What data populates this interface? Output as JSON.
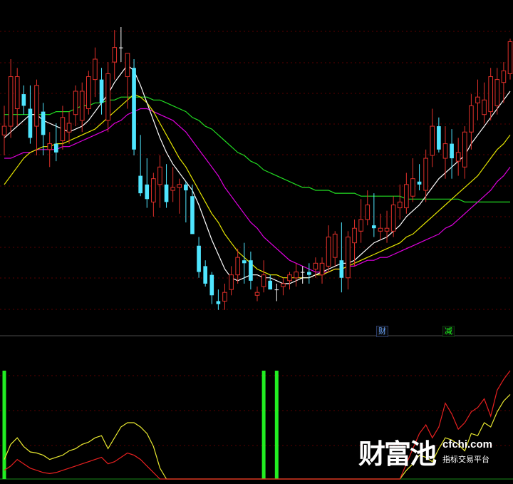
{
  "colors": {
    "background": "#000000",
    "grid": "#5a0000",
    "separator": "#4a4a4a",
    "candle_up": "#e0302a",
    "candle_down": "#4fe6ff",
    "doji": "#ffffff",
    "ma_short": "#ffffff",
    "ma_mid": "#e6e600",
    "ma_long": "#e000e0",
    "ma_longest": "#22dd22",
    "ind_yellow": "#e8e830",
    "ind_red": "#e82020",
    "ind_bar": "#22ee22"
  },
  "markers": {
    "cai": "财",
    "jian": "减"
  },
  "watermark": {
    "name": "财富池",
    "url": "cfchi.com",
    "tagline": "指标交易平台"
  },
  "chart_data": [
    {
      "type": "candlestick",
      "ylim": [
        0,
        100
      ],
      "grid": true,
      "candles": [
        {
          "o": 63,
          "h": 73,
          "l": 56,
          "c": 66
        },
        {
          "o": 66,
          "h": 89,
          "l": 62,
          "c": 83
        },
        {
          "o": 72,
          "h": 86,
          "l": 66,
          "c": 83
        },
        {
          "o": 77,
          "h": 80,
          "l": 70,
          "c": 73
        },
        {
          "o": 72,
          "h": 80,
          "l": 60,
          "c": 62
        },
        {
          "o": 66,
          "h": 82,
          "l": 56,
          "c": 80
        },
        {
          "o": 71,
          "h": 74,
          "l": 56,
          "c": 63
        },
        {
          "o": 58,
          "h": 64,
          "l": 52,
          "c": 60
        },
        {
          "o": 60,
          "h": 67,
          "l": 54,
          "c": 57
        },
        {
          "o": 61,
          "h": 73,
          "l": 58,
          "c": 69
        },
        {
          "o": 64,
          "h": 71,
          "l": 60,
          "c": 67
        },
        {
          "o": 70,
          "h": 80,
          "l": 66,
          "c": 78
        },
        {
          "o": 68,
          "h": 81,
          "l": 64,
          "c": 78
        },
        {
          "o": 72,
          "h": 85,
          "l": 70,
          "c": 83
        },
        {
          "o": 82,
          "h": 93,
          "l": 76,
          "c": 89
        },
        {
          "o": 82,
          "h": 86,
          "l": 70,
          "c": 74
        },
        {
          "o": 68,
          "h": 88,
          "l": 64,
          "c": 84
        },
        {
          "o": 88,
          "h": 99,
          "l": 82,
          "c": 93
        },
        {
          "o": 93,
          "h": 100,
          "l": 88,
          "c": 93
        },
        {
          "o": 83,
          "h": 91,
          "l": 72,
          "c": 91
        },
        {
          "o": 86,
          "h": 89,
          "l": 56,
          "c": 58
        },
        {
          "o": 49,
          "h": 63,
          "l": 42,
          "c": 43
        },
        {
          "o": 46,
          "h": 55,
          "l": 38,
          "c": 41
        },
        {
          "o": 40,
          "h": 50,
          "l": 35,
          "c": 48
        },
        {
          "o": 46,
          "h": 56,
          "l": 38,
          "c": 52
        },
        {
          "o": 46,
          "h": 53,
          "l": 38,
          "c": 40
        },
        {
          "o": 44,
          "h": 52,
          "l": 40,
          "c": 45
        },
        {
          "o": 45,
          "h": 48,
          "l": 36,
          "c": 46
        },
        {
          "o": 46,
          "h": 47,
          "l": 33,
          "c": 44
        },
        {
          "o": 42,
          "h": 46,
          "l": 33,
          "c": 29
        },
        {
          "o": 25,
          "h": 28,
          "l": 14,
          "c": 16
        },
        {
          "o": 18,
          "h": 20,
          "l": 11,
          "c": 12
        },
        {
          "o": 15,
          "h": 16,
          "l": 5,
          "c": 8
        },
        {
          "o": 6,
          "h": 10,
          "l": 3,
          "c": 5
        },
        {
          "o": 6,
          "h": 12,
          "l": 3,
          "c": 9
        },
        {
          "o": 10,
          "h": 18,
          "l": 8,
          "c": 15
        },
        {
          "o": 15,
          "h": 24,
          "l": 12,
          "c": 21
        },
        {
          "o": 20,
          "h": 26,
          "l": 12,
          "c": 19
        },
        {
          "o": 20,
          "h": 23,
          "l": 10,
          "c": 13
        },
        {
          "o": 8,
          "h": 11,
          "l": 6,
          "c": 9
        },
        {
          "o": 11,
          "h": 20,
          "l": 9,
          "c": 15
        },
        {
          "o": 13,
          "h": 15,
          "l": 10,
          "c": 10
        },
        {
          "o": 10,
          "h": 12,
          "l": 6,
          "c": 10
        },
        {
          "o": 11,
          "h": 14,
          "l": 8,
          "c": 12
        },
        {
          "o": 13,
          "h": 16,
          "l": 10,
          "c": 15
        },
        {
          "o": 14,
          "h": 19,
          "l": 11,
          "c": 16
        },
        {
          "o": 16,
          "h": 18,
          "l": 12,
          "c": 16
        },
        {
          "o": 16,
          "h": 19,
          "l": 12,
          "c": 15
        },
        {
          "o": 17,
          "h": 21,
          "l": 14,
          "c": 19
        },
        {
          "o": 15,
          "h": 21,
          "l": 12,
          "c": 19
        },
        {
          "o": 18,
          "h": 32,
          "l": 16,
          "c": 28
        },
        {
          "o": 21,
          "h": 30,
          "l": 18,
          "c": 29
        },
        {
          "o": 20,
          "h": 33,
          "l": 9,
          "c": 14
        },
        {
          "o": 14,
          "h": 30,
          "l": 10,
          "c": 28
        },
        {
          "o": 26,
          "h": 34,
          "l": 18,
          "c": 31
        },
        {
          "o": 30,
          "h": 41,
          "l": 26,
          "c": 34
        },
        {
          "o": 34,
          "h": 44,
          "l": 32,
          "c": 39
        },
        {
          "o": 32,
          "h": 43,
          "l": 28,
          "c": 31
        },
        {
          "o": 30,
          "h": 36,
          "l": 27,
          "c": 31
        },
        {
          "o": 30,
          "h": 37,
          "l": 26,
          "c": 31
        },
        {
          "o": 30,
          "h": 42,
          "l": 28,
          "c": 39
        },
        {
          "o": 38,
          "h": 46,
          "l": 34,
          "c": 40
        },
        {
          "o": 38,
          "h": 50,
          "l": 36,
          "c": 46
        },
        {
          "o": 42,
          "h": 55,
          "l": 40,
          "c": 48
        },
        {
          "o": 47,
          "h": 53,
          "l": 44,
          "c": 46
        },
        {
          "o": 44,
          "h": 58,
          "l": 40,
          "c": 55
        },
        {
          "o": 56,
          "h": 72,
          "l": 52,
          "c": 66
        },
        {
          "o": 66,
          "h": 69,
          "l": 57,
          "c": 58
        },
        {
          "o": 55,
          "h": 66,
          "l": 48,
          "c": 60
        },
        {
          "o": 60,
          "h": 65,
          "l": 48,
          "c": 55
        },
        {
          "o": 54,
          "h": 62,
          "l": 49,
          "c": 57
        },
        {
          "o": 52,
          "h": 66,
          "l": 48,
          "c": 64
        },
        {
          "o": 64,
          "h": 77,
          "l": 58,
          "c": 73
        },
        {
          "o": 74,
          "h": 82,
          "l": 68,
          "c": 76
        },
        {
          "o": 70,
          "h": 81,
          "l": 67,
          "c": 75
        },
        {
          "o": 71,
          "h": 86,
          "l": 68,
          "c": 83
        },
        {
          "o": 73,
          "h": 86,
          "l": 70,
          "c": 82
        },
        {
          "o": 81,
          "h": 88,
          "l": 74,
          "c": 85
        },
        {
          "o": 84,
          "h": 96,
          "l": 82,
          "c": 95
        }
      ],
      "ma_short": [
        62,
        64,
        66,
        68,
        70,
        70,
        68,
        67,
        66,
        65,
        64,
        65,
        66,
        68,
        71,
        74,
        77,
        81,
        84,
        87,
        85,
        80,
        74,
        68,
        62,
        57,
        53,
        50,
        47,
        44,
        39,
        33,
        27,
        22,
        17,
        14,
        13,
        14,
        15,
        15,
        14,
        14,
        13,
        12,
        12,
        13,
        14,
        14,
        15,
        16,
        17,
        18,
        19,
        19,
        20,
        22,
        24,
        26,
        27,
        28,
        30,
        32,
        35,
        37,
        39,
        42,
        45,
        48,
        50,
        52,
        54,
        56,
        60,
        63,
        66,
        69,
        72,
        75,
        78
      ],
      "ma_mid": [
        46,
        49,
        52,
        55,
        57,
        58,
        59,
        59,
        60,
        60,
        61,
        62,
        63,
        64,
        65,
        67,
        69,
        71,
        73,
        75,
        77,
        76,
        74,
        71,
        67,
        63,
        59,
        55,
        52,
        48,
        44,
        40,
        36,
        33,
        29,
        26,
        23,
        21,
        19,
        17,
        16,
        15,
        15,
        14,
        14,
        14,
        14,
        14,
        15,
        15,
        16,
        17,
        17,
        18,
        19,
        20,
        21,
        22,
        23,
        24,
        25,
        26,
        28,
        29,
        31,
        33,
        35,
        37,
        39,
        41,
        43,
        45,
        47,
        49,
        52,
        55,
        58,
        60,
        63
      ],
      "ma_long": [
        55,
        55,
        56,
        57,
        57,
        58,
        58,
        58,
        58,
        59,
        59,
        60,
        61,
        62,
        63,
        64,
        65,
        67,
        68,
        70,
        71,
        72,
        72,
        71,
        70,
        69,
        68,
        66,
        64,
        61,
        58,
        55,
        52,
        49,
        45,
        42,
        39,
        36,
        33,
        31,
        28,
        26,
        24,
        22,
        20,
        19,
        18,
        17,
        16,
        16,
        16,
        17,
        17,
        18,
        18,
        19,
        20,
        20,
        21,
        21,
        22,
        23,
        24,
        25,
        26,
        27,
        28,
        29,
        31,
        32,
        34,
        36,
        38,
        40,
        42,
        44,
        47,
        49,
        52
      ],
      "ma_longest": [
        70,
        70,
        70,
        70,
        70,
        70,
        70,
        70,
        71,
        71,
        71,
        72,
        73,
        73,
        74,
        74,
        75,
        75,
        76,
        76,
        76,
        76,
        76,
        75,
        75,
        74,
        73,
        72,
        71,
        69,
        68,
        66,
        65,
        63,
        61,
        59,
        57,
        56,
        54,
        53,
        51,
        50,
        49,
        48,
        47,
        46,
        45,
        45,
        44,
        44,
        44,
        43,
        43,
        43,
        43,
        42,
        42,
        42,
        42,
        42,
        42,
        42,
        41,
        41,
        41,
        41,
        41,
        41,
        41,
        41,
        41,
        40,
        40,
        40,
        40,
        40,
        40,
        40,
        40
      ]
    },
    {
      "type": "line",
      "ylim": [
        0,
        100
      ],
      "grid": true,
      "series": [
        {
          "values": [
            18,
            32,
            38,
            30,
            25,
            24,
            22,
            18,
            20,
            22,
            26,
            28,
            32,
            34,
            38,
            40,
            28,
            38,
            48,
            52,
            52,
            48,
            42,
            30,
            10,
            0,
            0,
            0,
            0,
            0,
            0,
            0,
            0,
            0,
            0,
            0,
            0,
            0,
            0,
            0,
            0,
            0,
            0,
            0,
            0,
            0,
            0,
            0,
            0,
            0,
            0,
            0,
            0,
            0,
            0,
            0,
            0,
            0,
            0,
            0,
            0,
            0,
            8,
            14,
            22,
            20,
            16,
            28,
            38,
            36,
            32,
            26,
            42,
            40,
            52,
            48,
            62,
            72,
            78
          ]
        },
        {
          "values": [
            8,
            12,
            18,
            14,
            10,
            8,
            6,
            5,
            6,
            8,
            10,
            12,
            14,
            16,
            18,
            20,
            14,
            16,
            20,
            24,
            22,
            18,
            12,
            6,
            0,
            0,
            0,
            0,
            0,
            0,
            0,
            0,
            0,
            0,
            0,
            0,
            0,
            0,
            0,
            0,
            0,
            0,
            0,
            0,
            0,
            0,
            0,
            0,
            0,
            0,
            0,
            0,
            0,
            0,
            0,
            0,
            0,
            0,
            0,
            0,
            0,
            0,
            14,
            28,
            42,
            50,
            38,
            48,
            70,
            60,
            46,
            52,
            62,
            66,
            74,
            58,
            82,
            92,
            100
          ]
        }
      ],
      "bars_at": [
        0,
        40,
        42
      ],
      "bars_height": 100
    }
  ]
}
